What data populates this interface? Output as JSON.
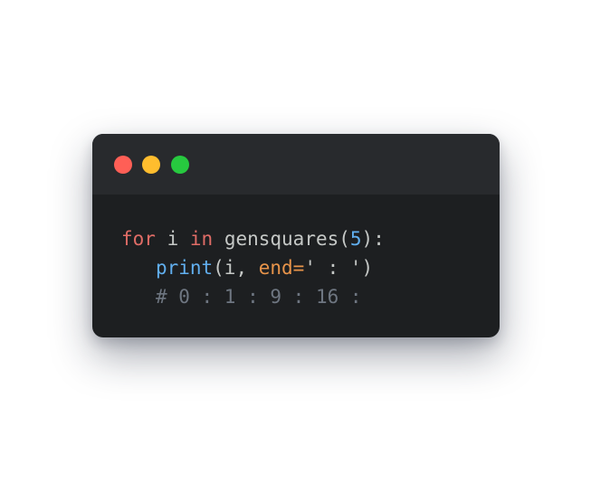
{
  "window": {
    "buttons": {
      "close": "close",
      "minimize": "minimize",
      "zoom": "zoom"
    }
  },
  "code": {
    "line1": {
      "kw_for": "for",
      "var_i": " i ",
      "kw_in": "in",
      "call": " gensquares(",
      "arg": "5",
      "close": "):"
    },
    "line2": {
      "indent": "   ",
      "fn": "print",
      "args": "(i, ",
      "param": "end=",
      "str": "' : '",
      "close": ")"
    },
    "line3": {
      "indent": "   ",
      "comment": "# 0 : 1 : 9 : 16 :"
    }
  },
  "colors": {
    "background": "#ffffff",
    "window_body": "#1d1f21",
    "titlebar": "#282a2d",
    "close": "#ff5f56",
    "minimize": "#ffbd2e",
    "zoom": "#27c93f",
    "keyword": "#e06c66",
    "number": "#61afef",
    "builtin": "#61afef",
    "parameter": "#e8944a",
    "comment": "#6e7681"
  }
}
